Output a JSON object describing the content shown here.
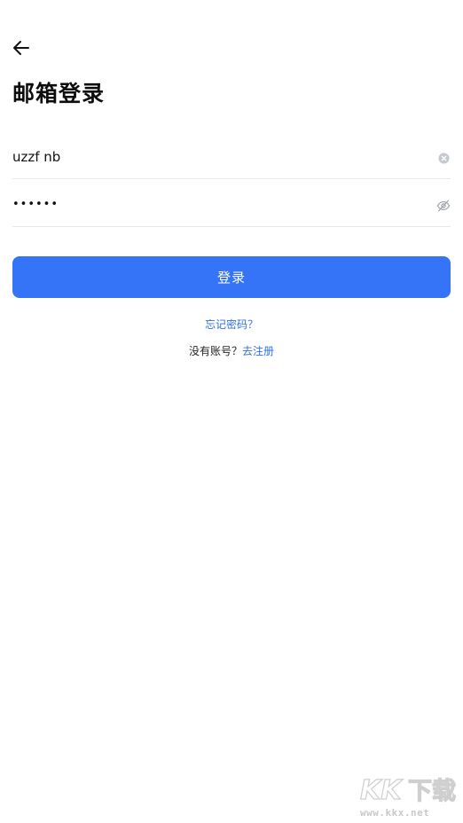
{
  "header": {
    "back_icon": "arrow-left-icon",
    "title": "邮箱登录"
  },
  "form": {
    "email": {
      "value": "uzzf nb",
      "clear_icon": "clear-circle-icon"
    },
    "password": {
      "value": "••••••",
      "visibility_icon": "eye-off-icon"
    },
    "login_label": "登录",
    "accent_color": "#3574f6"
  },
  "links": {
    "forgot_password": "忘记密码？",
    "no_account": "没有账号？",
    "register": "去注册"
  },
  "watermark": {
    "logo_text": "KK下载",
    "url": "www.kkx.net"
  }
}
